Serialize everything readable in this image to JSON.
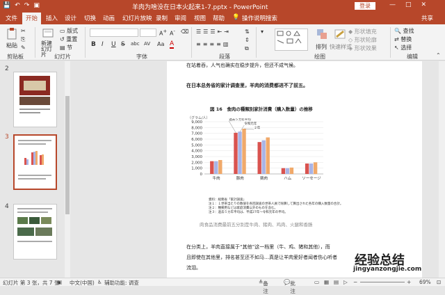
{
  "titlebar": {
    "title": "羊肉为啥没在日本火起来1-7.pptx - PowerPoint",
    "login": "登录",
    "qat": [
      "💾",
      "↶",
      "↷",
      "▣"
    ],
    "win": [
      "—",
      "□",
      "✕"
    ]
  },
  "tabs": [
    "文件",
    "开始",
    "插入",
    "设计",
    "切换",
    "动画",
    "幻灯片放映",
    "录制",
    "审阅",
    "视图",
    "帮助",
    "操作说明搜索"
  ],
  "share": "共享",
  "ribbon": {
    "paste": "粘贴",
    "new_slide": "新建幻灯片",
    "layout": "版式",
    "reset": "重置",
    "section": "节",
    "fill": "形状填充",
    "outline": "形状轮廓",
    "effect": "形状效果",
    "arrange": "排列",
    "quick": "快速样式",
    "find": "查找",
    "replace": "替换",
    "select": "选择",
    "groups": [
      "剪贴板",
      "幻灯片",
      "字体",
      "段落",
      "绘图",
      "编辑"
    ],
    "format_buttons": [
      "B",
      "I",
      "U",
      "S",
      "abc",
      "AV",
      "Aa",
      "A"
    ]
  },
  "thumbnails": [
    "2",
    "3",
    "4"
  ],
  "slide": {
    "line1": "在站着吞，人气也确实在稳步提升，但还不成气候。",
    "heading": "在日本总务省的家计调查里，羊肉的消费都进不了前五。",
    "chart_title": "図 16　食肉の種類別家計消費（購入数量）の推移",
    "unit": "（グラム/人）",
    "notes": [
      "資料：総務省「家計調査」",
      "注１：１世帯当たりの数値を各回調査の世帯人員で除算して算出された各年の購入数量の合計。",
      "注２：種類用などは家庭消費以外のものを含む。",
      "注３：過去５カ年平均は、平成27年～令和元年の平均。"
    ],
    "caption": "肉食品消费最前五分别是牛肉、猪肉、鸡肉、火腿和香肠",
    "para1": "在分类上，羊肉直接属于“其他”这一档里（牛、鸡、猪和其他），而",
    "para2": "且即使在其他里，排名甚至还不如马…真是让羊肉爱好者闻者伤心听者",
    "para3": "流泪。"
  },
  "chart_data": {
    "type": "bar",
    "categories": [
      "牛肉",
      "豚肉",
      "鶏肉",
      "ハム",
      "ソーセージ"
    ],
    "series": [
      {
        "name": "過去５カ年平均",
        "values": [
          2200,
          7100,
          5500,
          1000,
          1800
        ]
      },
      {
        "name": "令和元年",
        "values": [
          2200,
          7300,
          5800,
          1000,
          1800
        ]
      },
      {
        "name": "２年",
        "values": [
          2400,
          7800,
          6300,
          1100,
          2000
        ]
      }
    ],
    "series_colors": [
      "#d9534f",
      "#a9b4e6",
      "#f0a96a"
    ],
    "ylim": [
      0,
      9000
    ],
    "yticks": [
      "0",
      "1,000",
      "2,000",
      "3,000",
      "4,000",
      "5,000",
      "6,000",
      "7,000",
      "8,000",
      "9,000"
    ]
  },
  "status": {
    "slide": "幻灯片 第 3 张，共 7 张",
    "lang": "中文(中国)",
    "access": "辅助功能: 调查",
    "notes": "备注",
    "comments": "批注",
    "zoom": "69%"
  },
  "watermark": {
    "cn": "经验总结",
    "url": "jingyanzongjie.com"
  }
}
